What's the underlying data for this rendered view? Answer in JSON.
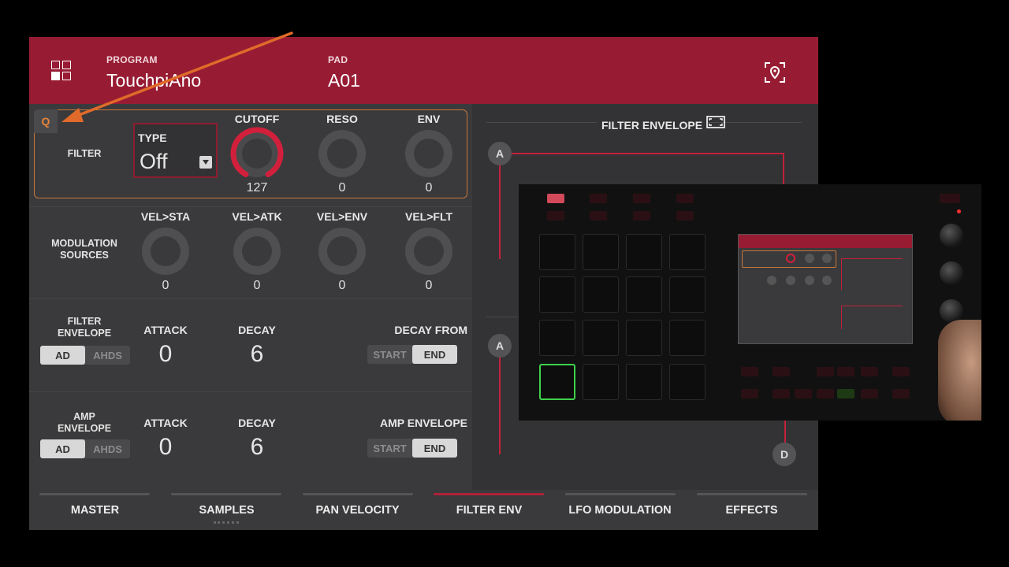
{
  "header": {
    "program_label": "PROGRAM",
    "program_value": "TouchpiAno",
    "pad_label": "PAD",
    "pad_value": "A01"
  },
  "filter": {
    "q_label": "Q",
    "row_label": "FILTER",
    "type_label": "TYPE",
    "type_value": "Off",
    "knobs": [
      {
        "label": "CUTOFF",
        "value": "127",
        "level": 1.0
      },
      {
        "label": "RESO",
        "value": "0",
        "level": 0
      },
      {
        "label": "ENV",
        "value": "0",
        "level": 0
      }
    ]
  },
  "modulation": {
    "row_label": "MODULATION SOURCES",
    "knobs": [
      {
        "label": "VEL>STA",
        "value": "0"
      },
      {
        "label": "VEL>ATK",
        "value": "0"
      },
      {
        "label": "VEL>ENV",
        "value": "0"
      },
      {
        "label": "VEL>FLT",
        "value": "0"
      }
    ]
  },
  "filter_envelope": {
    "row_label": "FILTER ENVELOPE",
    "mode_options": [
      "AD",
      "AHDS"
    ],
    "mode_selected": "AD",
    "attack_label": "ATTACK",
    "attack_value": "0",
    "decay_label": "DECAY",
    "decay_value": "6",
    "decay_from_label": "DECAY FROM",
    "decay_from_options": [
      "START",
      "END"
    ],
    "decay_from_selected": "END"
  },
  "amp_envelope": {
    "row_label": "AMP ENVELOPE",
    "mode_options": [
      "AD",
      "AHDS"
    ],
    "mode_selected": "AD",
    "attack_label": "ATTACK",
    "attack_value": "0",
    "decay_label": "DECAY",
    "decay_value": "6",
    "env_label": "AMP ENVELOPE",
    "env_options": [
      "START",
      "END"
    ],
    "env_selected": "END"
  },
  "right_panel": {
    "title": "FILTER ENVELOPE",
    "node_a1": "A",
    "node_a2": "A",
    "node_d": "D"
  },
  "tabs": [
    {
      "label": "MASTER",
      "active": false
    },
    {
      "label": "SAMPLES",
      "active": false
    },
    {
      "label": "PAN VELOCITY",
      "active": false
    },
    {
      "label": "FILTER ENV",
      "active": true
    },
    {
      "label": "LFO MODULATION",
      "active": false
    },
    {
      "label": "EFFECTS",
      "active": false
    }
  ],
  "colors": {
    "accent_red": "#971c33",
    "knob_active": "#d2203c",
    "outline_orange": "#c8773a",
    "arrow_orange": "#e06a2a"
  },
  "icons": {
    "menu": "grid-icon",
    "locate": "locate-icon",
    "dropdown": "chevron-down-icon",
    "fullscreen": "expand-icon"
  }
}
